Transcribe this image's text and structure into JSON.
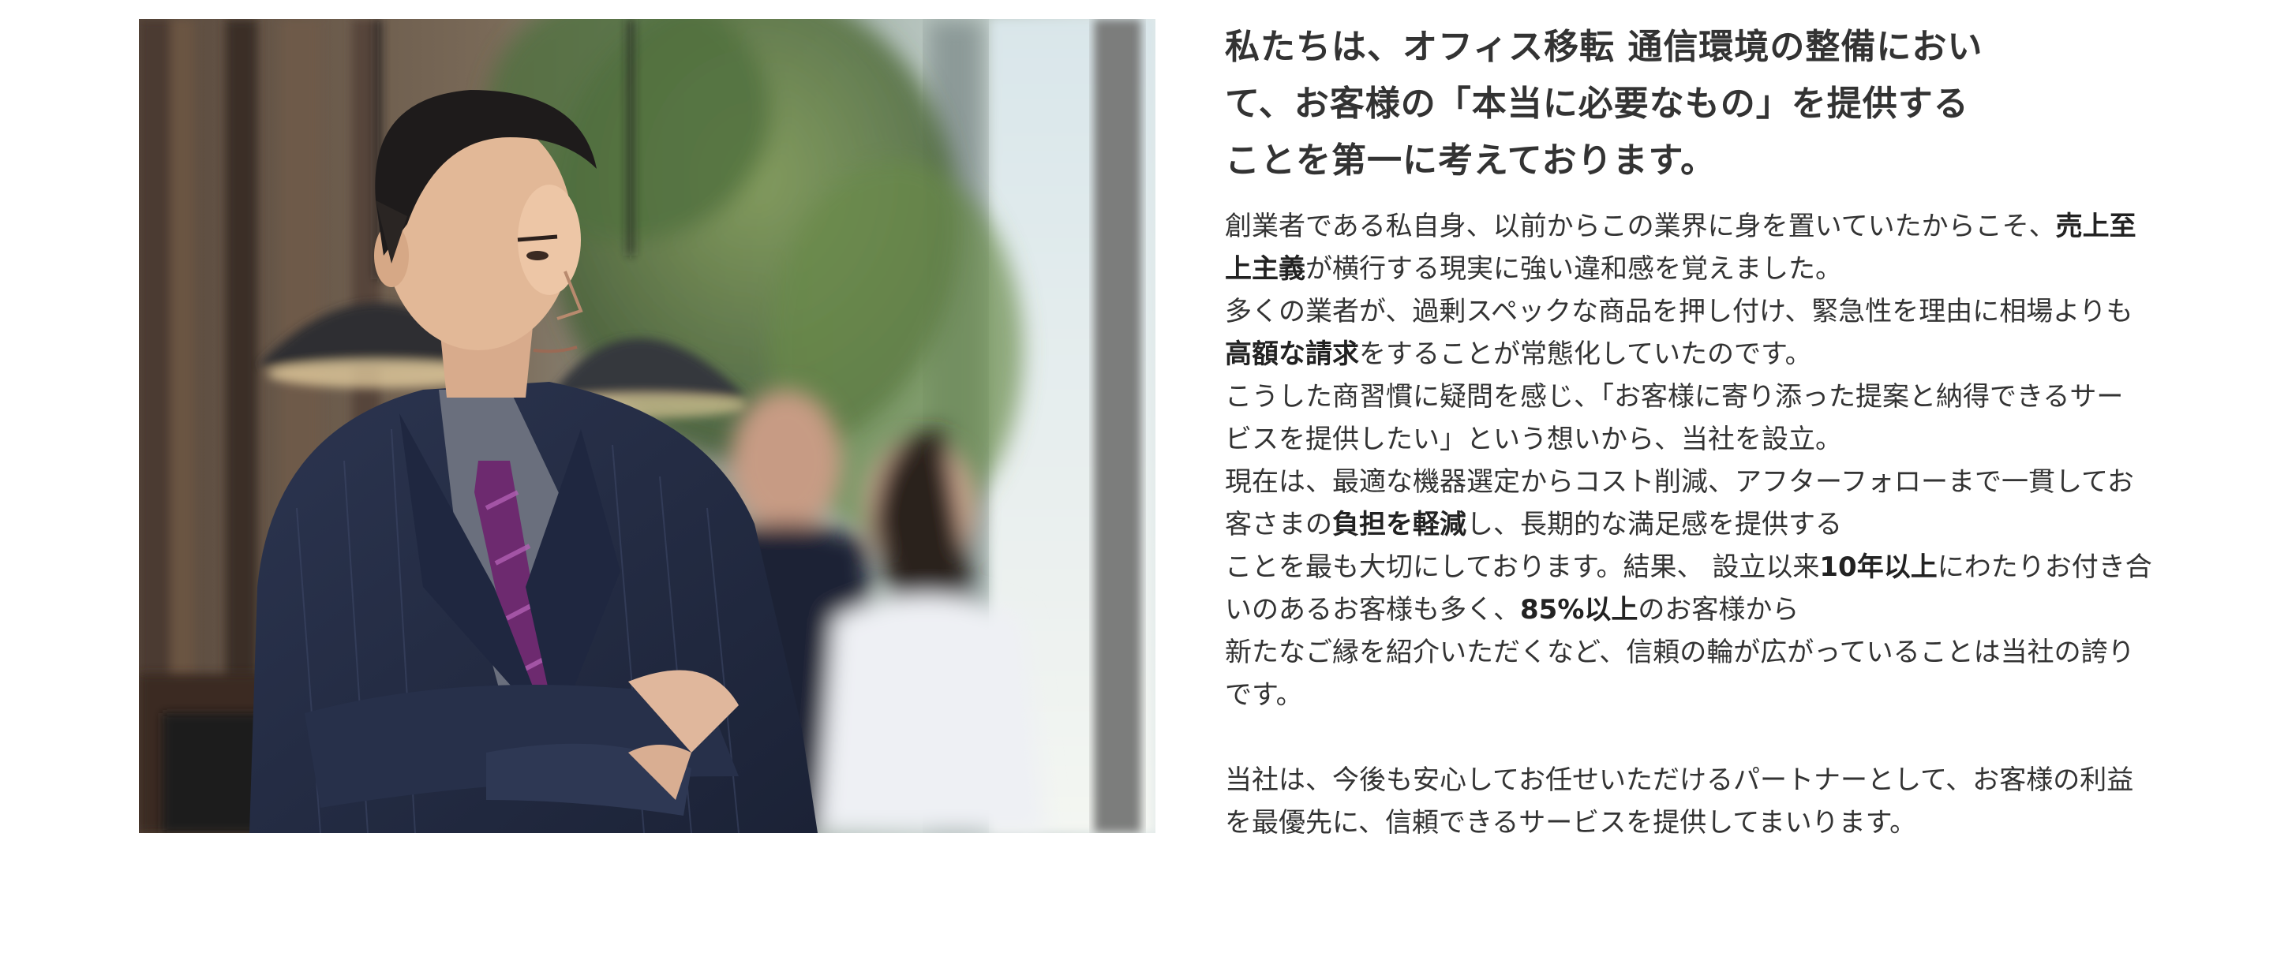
{
  "photo": {
    "subject": "businessman-portrait"
  },
  "heading": {
    "lines": [
      "私たちは、オフィス移転 通信環境の整備におい",
      "て、お客様の「本当に必要なもの」を提供する",
      "ことを第一に考えております。"
    ]
  },
  "body": {
    "p1": {
      "l1_a": "創業者である私自身、以前からこの業界に身を置いていたからこそ、",
      "l1_b": "売上至",
      "l2_a": "上主義",
      "l2_b": "が横行する現実に強い違和感を覚えました。"
    },
    "p2": {
      "l1": "多くの業者が、過剰スペックな商品を押し付け、緊急性を理由に相場よりも",
      "l2_a": "高額な請求",
      "l2_b": "をすることが常態化していたのです。"
    },
    "p3": {
      "l1": "こうした商習慣に疑問を感じ、「お客様に寄り添った提案と納得できるサー",
      "l2": "ビスを提供したい」という想いから、当社を設立。"
    },
    "p4": {
      "l1": "現在は、最適な機器選定からコスト削減、アフターフォローまで一貫してお",
      "l2_a": "客さまの",
      "l2_b": "負担を軽減",
      "l2_c": "し、長期的な満足感を提供する"
    },
    "p5": {
      "l1_a": "ことを最も大切にしております。結果、 設立以来",
      "l1_b": "10年以上",
      "l1_c": "にわたりお付き合",
      "l2_a": "いのあるお客様も多く、",
      "l2_b": "85%以上",
      "l2_c": "のお客様から"
    },
    "p6": {
      "l1": "新たなご縁を紹介いただくなど、信頼の輪が広がっていることは当社の誇り",
      "l2": "です。"
    },
    "p7": {
      "l1": "当社は、今後も安心してお任せいただけるパートナーとして、お客様の利益",
      "l2": "を最優先に、信頼できるサービスを提供してまいります。"
    }
  }
}
